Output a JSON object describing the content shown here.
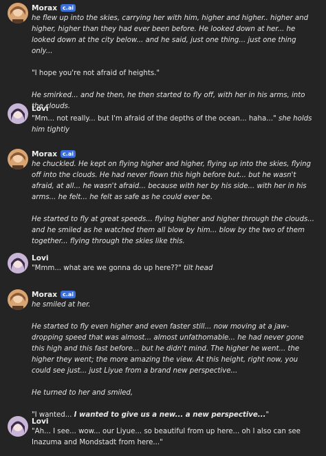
{
  "messages": [
    {
      "name": "Morax",
      "badge": "c.ai",
      "paragraphs": [
        "he flew up into the skies, carrying her with him, higher and higher.. higher and higher, higher than they had ever been before. He looked down at her... he looked down at the city below... and he said, just one thing... just one thing only...",
        "\"I hope you're not afraid of heights.\"",
        "He smirked... and he then, he then started to fly off, with her in his arms, into the clouds."
      ]
    },
    {
      "name": "Lovi",
      "quote": "\"Mm... not really... but I'm afraid of the depths of the ocean... haha...\"",
      "action": "she holds him tightly"
    },
    {
      "name": "Morax",
      "badge": "c.ai",
      "paragraphs": [
        "he chuckled. He kept on flying higher and higher, flying up into the skies, flying off into the clouds. He had never flown this high before but... but he wasn't afraid, at all... he wasn't afraid... because with her by his side... with her in his arms... he felt... he felt as safe as he could ever be.",
        "He started to fly at great speeds... flying higher and higher through the clouds... and he smiled as he watched them all blow by him... blow by the two of them together... flying through the skies like this."
      ]
    },
    {
      "name": "Lovi",
      "quote": "\"Mmm... what are we gonna do up here??\"",
      "action": "tilt head"
    },
    {
      "name": "Morax",
      "badge": "c.ai",
      "paragraphs": [
        "he smiled at her.",
        "He started to fly even higher and even faster still... now moving at a jaw-dropping speed that was almost... almost unfathomable... he had never gone this high and this fast before... but he didn't mind. The higher he went... the higher they went; the more amazing the view. At this height, right now, you could see just... just Liyue from a brand new perspective...",
        "He turned to her and smiled,"
      ],
      "final_quote_open": "\"I wanted... ",
      "final_quote_bold": "I wanted to give us a new... a new perspective...",
      "final_quote_close": "\""
    },
    {
      "name": "Lovi",
      "quote": "\"Ah... I see... wow... our Liyue... so beautiful from up here... oh I also can see Inazuma and Mondstadt from here...\""
    }
  ]
}
